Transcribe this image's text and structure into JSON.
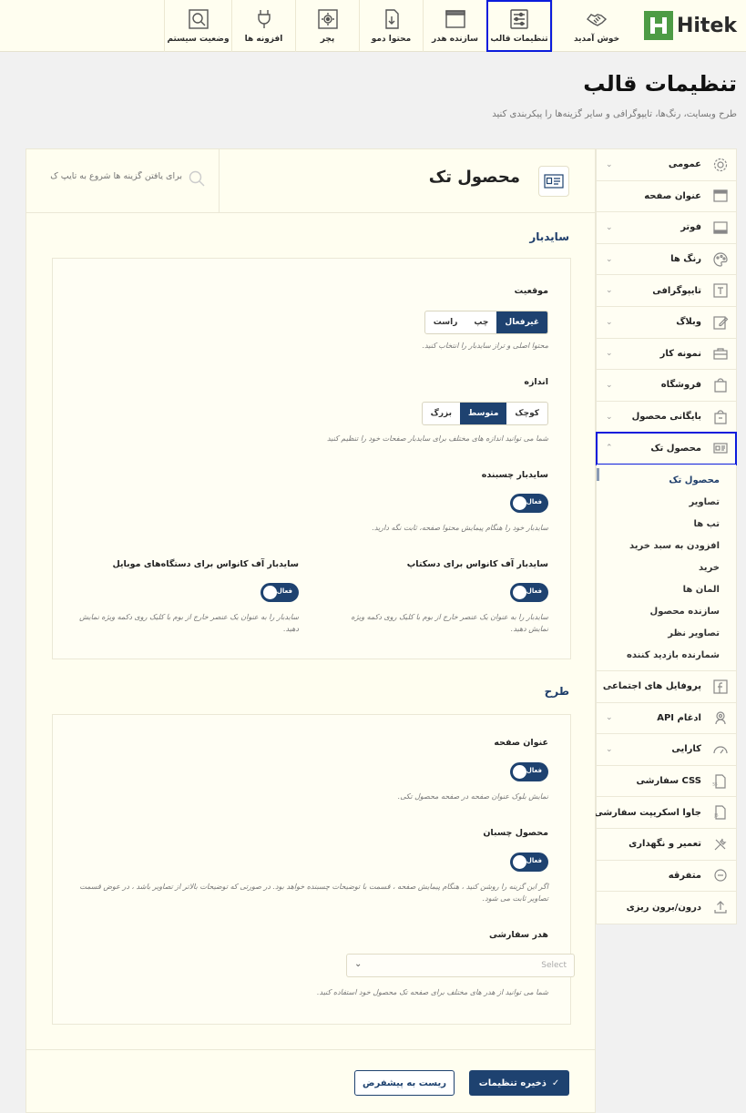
{
  "brand": {
    "name": "Hitek",
    "letter": "H"
  },
  "nav": [
    {
      "label": "خوش آمدید",
      "icon": "handshake-icon"
    },
    {
      "label": "تنظیمات قالب",
      "icon": "sliders-icon"
    },
    {
      "label": "سازنده هدر",
      "icon": "window-icon"
    },
    {
      "label": "محتوا دمو",
      "icon": "download-doc-icon"
    },
    {
      "label": "پچر",
      "icon": "gear-box-icon"
    },
    {
      "label": "افزونه ها",
      "icon": "plug-icon"
    },
    {
      "label": "وضعیت سیستم",
      "icon": "search-box-icon"
    }
  ],
  "page": {
    "title": "تنظیمات قالب",
    "subtitle": "طرح وبسایت، رنگ‌ها، تایپوگرافی و سایر گزینه‌ها را پیکربندی کنید"
  },
  "sidebar": {
    "items_top": [
      {
        "label": "عمومی",
        "icon": "gear-icon",
        "chevron": true
      },
      {
        "label": "عنوان صفحه",
        "icon": "title-bar-icon",
        "chevron": false
      },
      {
        "label": "فوتر",
        "icon": "footer-icon",
        "chevron": true
      },
      {
        "label": "رنگ ها",
        "icon": "palette-icon",
        "chevron": true
      },
      {
        "label": "تایپوگرافی",
        "icon": "typography-icon",
        "chevron": true
      },
      {
        "label": "وبلاگ",
        "icon": "edit-icon",
        "chevron": true
      },
      {
        "label": "نمونه کار",
        "icon": "briefcase-icon",
        "chevron": true
      },
      {
        "label": "فروشگاه",
        "icon": "shopping-bag-icon",
        "chevron": true
      },
      {
        "label": "بایگانی محصول",
        "icon": "archive-bag-icon",
        "chevron": true
      }
    ],
    "active": {
      "label": "محصول تک",
      "icon": "product-card-icon"
    },
    "sub_items": [
      "محصول تک",
      "تصاویر",
      "تب ها",
      "افزودن به سبد خرید",
      "خرید",
      "المان ها",
      "سازنده محصول",
      "تصاویر نظر",
      "شمارنده بازدید کننده"
    ],
    "items_bottom": [
      {
        "label": "پروفایل های اجتماعی",
        "icon": "facebook-icon",
        "chevron": true
      },
      {
        "label": "ادغام API",
        "icon": "api-icon",
        "chevron": true
      },
      {
        "label": "کارایی",
        "icon": "speedometer-icon",
        "chevron": true
      },
      {
        "label": "CSS سفارشی",
        "icon": "css-file-icon",
        "chevron": false
      },
      {
        "label": "جاوا اسکریپت سفارشی",
        "icon": "js-file-icon",
        "chevron": false
      },
      {
        "label": "تعمیر و نگهداری",
        "icon": "tools-icon",
        "chevron": false
      },
      {
        "label": "متفرقه",
        "icon": "minus-circle-icon",
        "chevron": false
      },
      {
        "label": "درون/برون ریزی",
        "icon": "upload-icon",
        "chevron": false
      }
    ]
  },
  "panel": {
    "title": "محصول تک",
    "search_placeholder": "برای یافتن گزینه ها شروع به تایپ ک",
    "sidebar_section": {
      "title": "سایدبار",
      "position": {
        "label": "موقعیت",
        "options": [
          "غیرفعال",
          "چپ",
          "راست"
        ],
        "selected": "غیرفعال",
        "desc": "محتوا اصلی و تراز سایدبار را انتخاب کنید."
      },
      "size": {
        "label": "اندازه",
        "options": [
          "کوچک",
          "متوسط",
          "بزرگ"
        ],
        "selected": "متوسط",
        "desc": "شما می توانید اندازه های مختلف برای سایدبار صفحات خود را تنظیم کنید"
      },
      "sticky": {
        "label": "سایدبار چسبنده",
        "toggle": "فعال",
        "desc": "سایدبار خود را هنگام پیمایش محتوا صفحه، ثابت نگه دارید."
      },
      "offcanvas_desktop": {
        "label": "سایدبار آف کانواس برای دسکتاپ",
        "toggle": "فعال",
        "desc": "سایدبار را به عنوان یک عنصر خارج از بوم با کلیک روی دکمه ویژه نمایش دهید."
      },
      "offcanvas_mobile": {
        "label": "سایدبار آف کانواس برای دستگاه‌های موبایل",
        "toggle": "فعال",
        "desc": "سایدبار را به عنوان یک عنصر خارج از بوم با کلیک روی دکمه ویژه نمایش دهید."
      }
    },
    "layout_section": {
      "title": "طرح",
      "page_title": {
        "label": "عنوان صفحه",
        "toggle": "فعال",
        "desc": "نمایش بلوک عنوان صفحه در صفحه محصول تکی."
      },
      "sticky_product": {
        "label": "محصول چسبان",
        "toggle": "فعال",
        "desc": "اگر این گزینه را روشن کنید ، هنگام پیمایش صفحه ، قسمت با توضیحات چسبنده خواهد بود. در صورتی که توضیحات بالاتر از تصاویر باشد ، در عوض قسمت تصاویر ثابت می شود."
      },
      "custom_header": {
        "label": "هدر سفارشی",
        "select_value": "Select",
        "desc": "شما می توانید از هدر های مختلف برای صفحه تک محصول خود استفاده کنید."
      }
    },
    "buttons": {
      "save": "ذخیره تنظیمات",
      "reset": "ریست به پیشفرض"
    }
  }
}
